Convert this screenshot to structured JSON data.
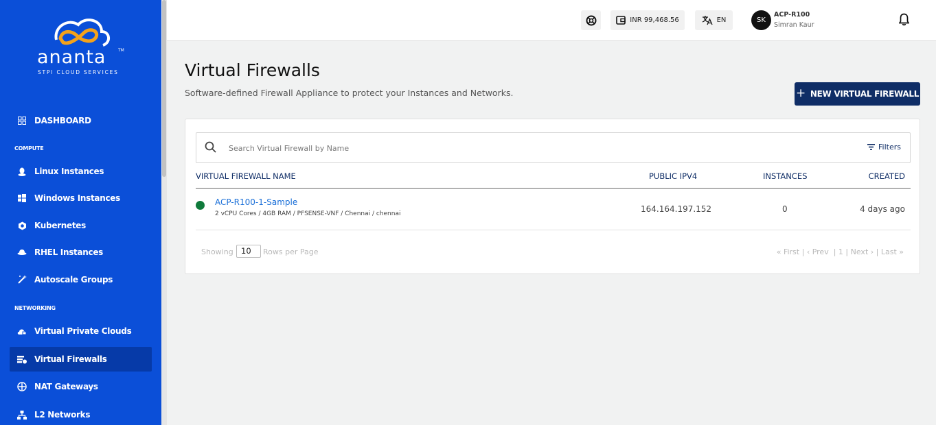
{
  "brand": {
    "name": "ananta",
    "tagline": "STPI CLOUD SERVICES",
    "tm": "TM",
    "colors": {
      "sidebar": "#0b4fd8",
      "active": "#063aa8",
      "primary": "#0f2d66",
      "link": "#1a6fd8",
      "status_ok": "#0f7a3b"
    }
  },
  "sidebar": {
    "dashboard": {
      "label": "DASHBOARD",
      "icon": "dashboard-icon"
    },
    "compute_label": "COMPUTE",
    "compute_items": [
      {
        "label": "Linux Instances",
        "icon": "linux-icon"
      },
      {
        "label": "Windows Instances",
        "icon": "windows-icon"
      },
      {
        "label": "Kubernetes",
        "icon": "kubernetes-icon"
      },
      {
        "label": "RHEL Instances",
        "icon": "redhat-icon"
      },
      {
        "label": "Autoscale Groups",
        "icon": "magic-wand-icon"
      }
    ],
    "networking_label": "NETWORKING",
    "networking_items": [
      {
        "label": "Virtual Private Clouds",
        "icon": "cloud-lock-icon"
      },
      {
        "label": "Virtual Firewalls",
        "icon": "firewall-icon",
        "active": true
      },
      {
        "label": "NAT Gateways",
        "icon": "gateway-icon"
      },
      {
        "label": "L2 Networks",
        "icon": "network-icon"
      }
    ]
  },
  "header": {
    "support_icon": "lifebuoy-icon",
    "wallet_icon": "wallet-icon",
    "balance": "INR 99,468.56",
    "language_icon": "translate-icon",
    "language": "EN",
    "avatar_initials": "SK",
    "account": "ACP-R100",
    "user_name": "Simran Kaur",
    "notification_icon": "bell-icon"
  },
  "page": {
    "title": "Virtual Firewalls",
    "subtitle": "Software-defined Firewall Appliance to protect your Instances and Networks.",
    "new_button": "NEW VIRTUAL FIREWALL"
  },
  "search": {
    "placeholder": "Search Virtual Firewall by Name",
    "value": "",
    "filters_label": "Filters"
  },
  "table": {
    "columns": [
      "VIRTUAL FIREWALL NAME",
      "PUBLIC IPV4",
      "INSTANCES",
      "CREATED"
    ],
    "rows": [
      {
        "status": "running",
        "name": "ACP-R100-1-Sample",
        "spec": "2 vCPU Cores / 4GB RAM / PFSENSE-VNF / Chennai / chennai",
        "ipv4": "164.164.197.152",
        "instances": "0",
        "created": "4 days ago"
      }
    ]
  },
  "pagination": {
    "showing": "Showing",
    "rows_per_page": "10",
    "rows_label": "Rows per Page",
    "first": "« First",
    "prev": "‹ Prev",
    "page": "1",
    "next": "Next ›",
    "last": "Last »"
  }
}
